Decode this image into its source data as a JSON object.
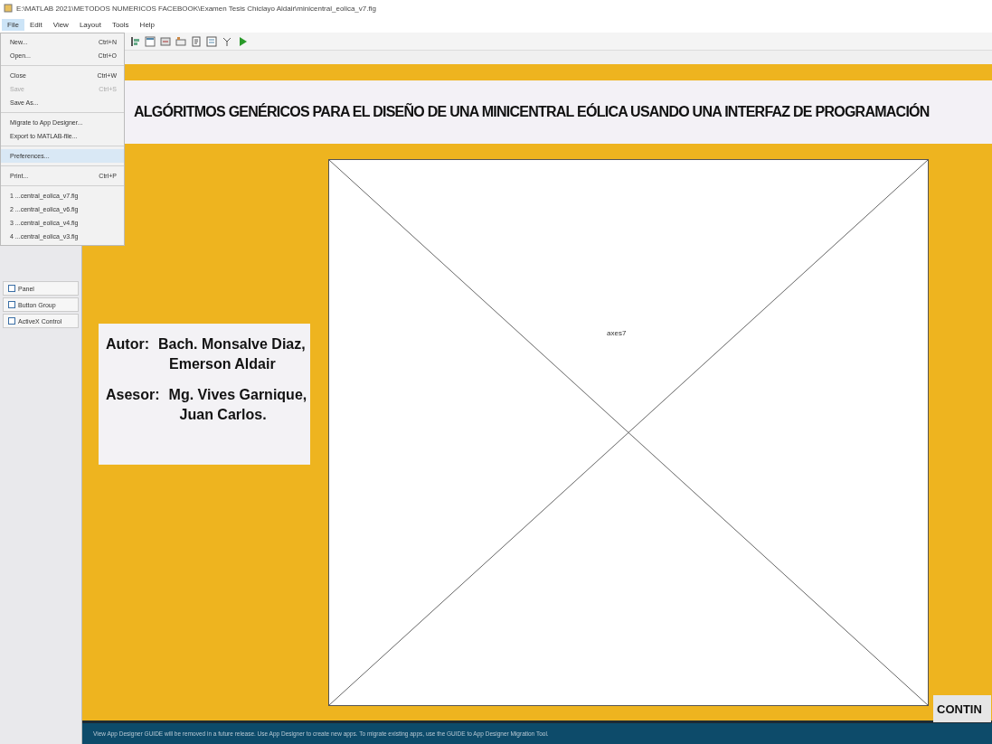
{
  "window": {
    "title": "E:\\MATLAB 2021\\METODOS NUMERICOS FACEBOOK\\Examen Tesis Chiclayo Aldair\\minicentral_eolica_v7.fig"
  },
  "menu_bar": [
    {
      "label": "File",
      "selected": true
    },
    {
      "label": "Edit",
      "selected": false
    },
    {
      "label": "View",
      "selected": false
    },
    {
      "label": "Layout",
      "selected": false
    },
    {
      "label": "Tools",
      "selected": false
    },
    {
      "label": "Help",
      "selected": false
    }
  ],
  "file_menu": [
    {
      "kind": "item",
      "label": "New...",
      "shortcut": "Ctrl+N",
      "disabled": false,
      "selected": false
    },
    {
      "kind": "item",
      "label": "Open...",
      "shortcut": "Ctrl+O",
      "disabled": false,
      "selected": false
    },
    {
      "kind": "separator"
    },
    {
      "kind": "item",
      "label": "Close",
      "shortcut": "Ctrl+W",
      "disabled": false,
      "selected": false
    },
    {
      "kind": "item",
      "label": "Save",
      "shortcut": "Ctrl+S",
      "disabled": true,
      "selected": false
    },
    {
      "kind": "item",
      "label": "Save As...",
      "disabled": false,
      "selected": false
    },
    {
      "kind": "separator"
    },
    {
      "kind": "item",
      "label": "Migrate to App Designer...",
      "disabled": false,
      "selected": false
    },
    {
      "kind": "item",
      "label": "Export to MATLAB-file...",
      "disabled": false,
      "selected": false
    },
    {
      "kind": "separator"
    },
    {
      "kind": "item",
      "label": "Preferences...",
      "disabled": false,
      "selected": true
    },
    {
      "kind": "separator"
    },
    {
      "kind": "item",
      "label": "Print...",
      "shortcut": "Ctrl+P",
      "disabled": false,
      "selected": false
    },
    {
      "kind": "separator"
    },
    {
      "kind": "item",
      "label": "1 ...central_eolica_v7.fig",
      "disabled": false,
      "selected": false
    },
    {
      "kind": "item",
      "label": "2 ...central_eolica_v6.fig",
      "disabled": false,
      "selected": false
    },
    {
      "kind": "item",
      "label": "3 ...central_eolica_v4.fig",
      "disabled": false,
      "selected": false
    },
    {
      "kind": "item",
      "label": "4 ...central_eolica_v3.fig",
      "disabled": false,
      "selected": false
    }
  ],
  "palette": [
    {
      "label": "Panel"
    },
    {
      "label": "Button Group"
    },
    {
      "label": "ActiveX Control"
    }
  ],
  "canvas": {
    "heading": "ALGÓRITMOS GENÉRICOS PARA EL DISEÑO DE UNA MINICENTRAL EÓLICA USANDO UNA INTERFAZ DE PROGRAMACIÓN",
    "credits": [
      {
        "label": "Autor:",
        "lines": [
          "Bach. Monsalve Diaz,",
          "Emerson Aldair"
        ]
      },
      {
        "label": "Asesor:",
        "lines": [
          "Mg. Vives Garnique,",
          "Juan Carlos."
        ]
      }
    ],
    "axes": {
      "tag": "axes7"
    },
    "button": {
      "label": "CONTIN"
    }
  },
  "status_bar": {
    "text": "View App Designer   GUIDE will be removed in a future release. Use App Designer to create new apps. To migrate existing apps, use the GUIDE to App Designer Migration Tool."
  }
}
